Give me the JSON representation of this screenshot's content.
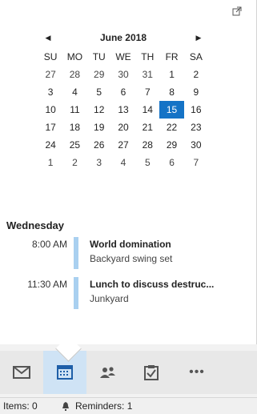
{
  "calendar": {
    "month_label": "June 2018",
    "weekdays": [
      "SU",
      "MO",
      "TU",
      "WE",
      "TH",
      "FR",
      "SA"
    ],
    "weeks": [
      [
        "27",
        "28",
        "29",
        "30",
        "31",
        "1",
        "2"
      ],
      [
        "3",
        "4",
        "5",
        "6",
        "7",
        "8",
        "9"
      ],
      [
        "10",
        "11",
        "12",
        "13",
        "14",
        "15",
        "16"
      ],
      [
        "17",
        "18",
        "19",
        "20",
        "21",
        "22",
        "23"
      ],
      [
        "24",
        "25",
        "26",
        "27",
        "28",
        "29",
        "30"
      ],
      [
        "1",
        "2",
        "3",
        "4",
        "5",
        "6",
        "7"
      ]
    ],
    "selected_day": "15",
    "accent_color": "#1573c6"
  },
  "agenda": {
    "day_label": "Wednesday",
    "appointments": [
      {
        "time": "8:00 AM",
        "subject": "World domination",
        "location": "Backyard swing set"
      },
      {
        "time": "11:30 AM",
        "subject": "Lunch to discuss destruc...",
        "location": "Junkyard"
      }
    ],
    "appointment_bar_color": "#a9d0f0"
  },
  "navbar": {
    "items": [
      {
        "name": "mail",
        "icon": "mail-icon"
      },
      {
        "name": "calendar",
        "icon": "calendar-icon",
        "active": true
      },
      {
        "name": "people",
        "icon": "people-icon"
      },
      {
        "name": "tasks",
        "icon": "tasks-icon"
      },
      {
        "name": "more",
        "icon": "more-icon",
        "label": "•••"
      }
    ]
  },
  "status": {
    "items_label": "Items: 0",
    "reminders_label": "Reminders: 1"
  }
}
